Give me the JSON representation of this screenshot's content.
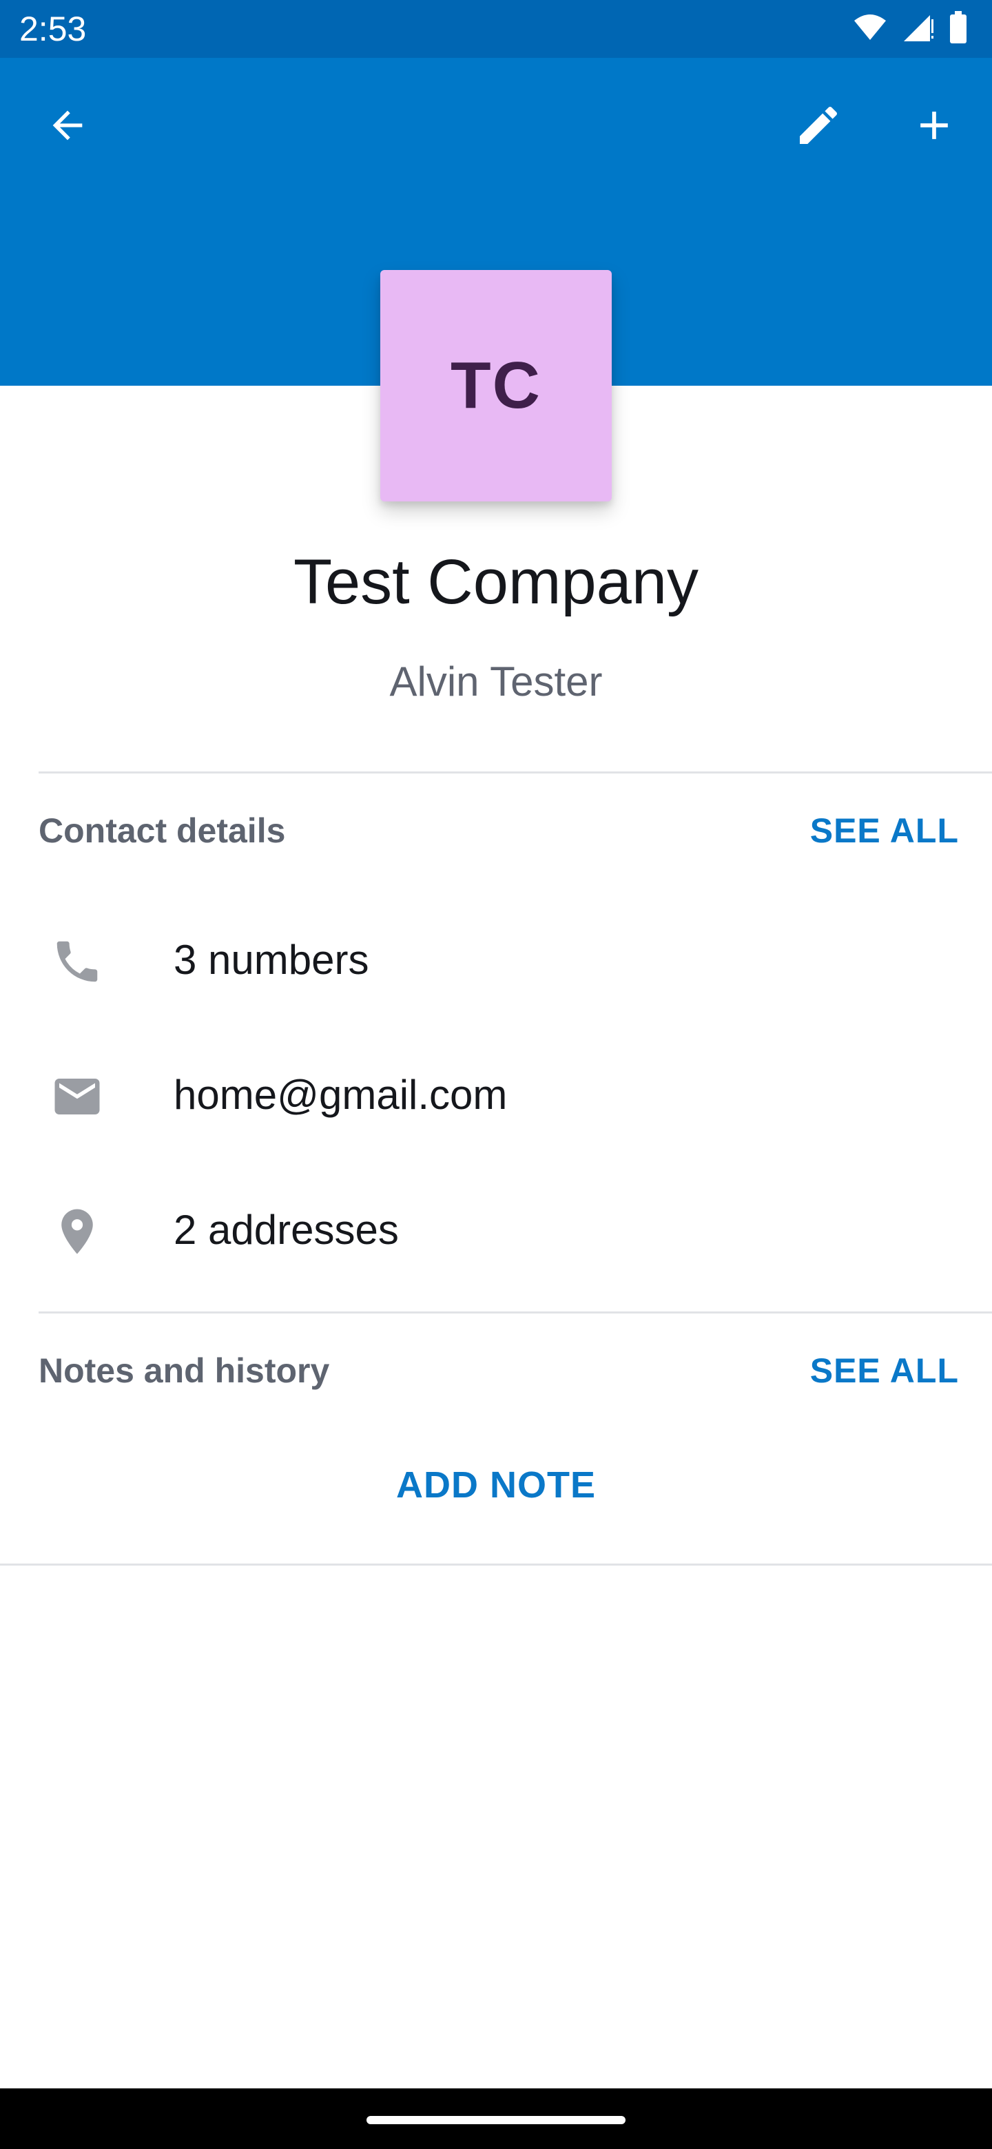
{
  "status_bar": {
    "time": "2:53",
    "icons": [
      "wifi-icon",
      "cellular-signal-icon",
      "battery-icon"
    ]
  },
  "app_bar": {
    "background": "#0078c8",
    "actions": [
      "back-arrow-icon",
      "edit-pencil-icon",
      "add-plus-icon"
    ]
  },
  "contact": {
    "initials": "TC",
    "avatar_color": "#e8b9f4",
    "company": "Test Company",
    "person": "Alvin Tester"
  },
  "contact_details": {
    "title": "Contact details",
    "see_all": "SEE ALL",
    "phone": "3 numbers",
    "email": "home@gmail.com",
    "address": "2 addresses"
  },
  "notes": {
    "title": "Notes and history",
    "see_all": "SEE ALL",
    "add_note": "ADD NOTE"
  },
  "colors": {
    "accent": "#0a78c8",
    "status_bar": "#0066b3"
  }
}
